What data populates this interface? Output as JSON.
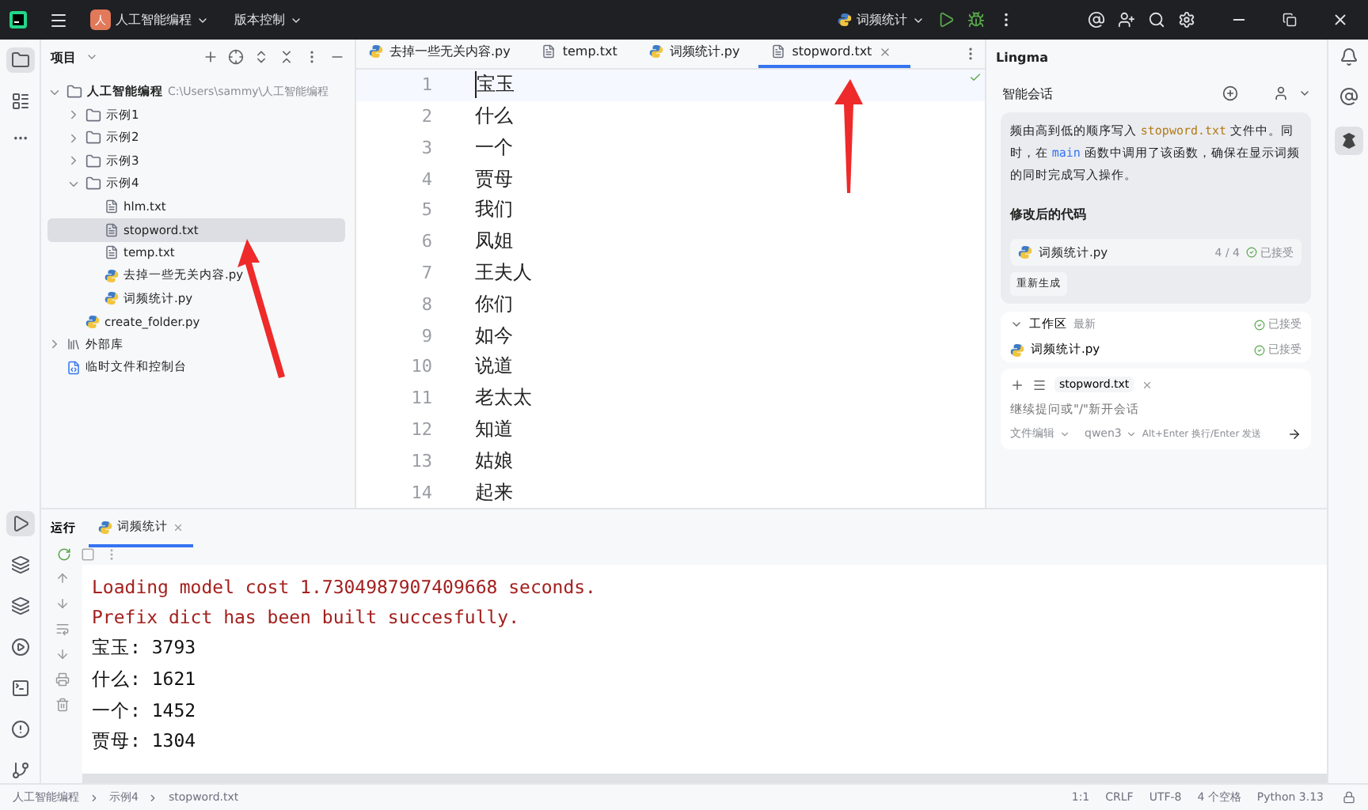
{
  "title_bar": {
    "project_badge": "人",
    "project": "人工智能编程",
    "vcs": "版本控制",
    "run_config": "词频统计"
  },
  "project_panel": {
    "title": "项目",
    "tree": [
      {
        "name": "人工智能编程",
        "path": "C:\\Users\\sammy\\人工智能编程",
        "kind": "folder",
        "expanded": true,
        "selected": false,
        "children": [
          {
            "name": "示例1",
            "kind": "folder",
            "expanded": false,
            "selected": false
          },
          {
            "name": "示例2",
            "kind": "folder",
            "expanded": false,
            "selected": false
          },
          {
            "name": "示例3",
            "kind": "folder",
            "expanded": false,
            "selected": false
          },
          {
            "name": "示例4",
            "kind": "folder",
            "expanded": true,
            "selected": false,
            "children": [
              {
                "name": "hlm.txt",
                "kind": "txt",
                "selected": false
              },
              {
                "name": "stopword.txt",
                "kind": "txt",
                "selected": true
              },
              {
                "name": "temp.txt",
                "kind": "txt",
                "selected": false
              },
              {
                "name": "去掉一些无关内容.py",
                "kind": "py",
                "selected": false
              },
              {
                "name": "词频统计.py",
                "kind": "py",
                "selected": false
              }
            ]
          },
          {
            "name": "create_folder.py",
            "kind": "py",
            "selected": false
          }
        ]
      },
      {
        "name": "外部库",
        "kind": "library",
        "expanded": false,
        "selected": false
      },
      {
        "name": "临时文件和控制台",
        "kind": "scratch",
        "selected": false
      }
    ]
  },
  "editor": {
    "tabs": [
      {
        "label": "去掉一些无关内容.py",
        "kind": "py",
        "selected": false
      },
      {
        "label": "temp.txt",
        "kind": "txt",
        "selected": false
      },
      {
        "label": "词频统计.py",
        "kind": "py",
        "selected": false
      },
      {
        "label": "stopword.txt",
        "kind": "txt",
        "selected": true
      }
    ],
    "lines": [
      {
        "number": "1",
        "text": "宝玉"
      },
      {
        "number": "2",
        "text": "什么"
      },
      {
        "number": "3",
        "text": "一个"
      },
      {
        "number": "4",
        "text": "贾母"
      },
      {
        "number": "5",
        "text": "我们"
      },
      {
        "number": "6",
        "text": "凤姐"
      },
      {
        "number": "7",
        "text": "王夫人"
      },
      {
        "number": "8",
        "text": "你们"
      },
      {
        "number": "9",
        "text": "如今"
      },
      {
        "number": "10",
        "text": "说道"
      },
      {
        "number": "11",
        "text": "老太太"
      },
      {
        "number": "12",
        "text": "知道"
      },
      {
        "number": "13",
        "text": "姑娘"
      },
      {
        "number": "14",
        "text": "起来"
      }
    ]
  },
  "lingma": {
    "title": "Lingma",
    "section": "智能会话",
    "message": [
      {
        "kind": "plain",
        "text": "频由高到低的顺序写入 "
      },
      {
        "kind": "code",
        "text": "stopword.txt"
      },
      {
        "kind": "plain",
        "text": " 文件中。同时，在 "
      },
      {
        "kind": "link",
        "text": "main"
      },
      {
        "kind": "plain",
        "text": " 函数中调用了该函数，确保在显示词频的同时完成写入操作。"
      }
    ],
    "heading": "修改后的代码",
    "file": {
      "name": "词频统计.py",
      "count": "4 / 4",
      "status": "已接受"
    },
    "regenerate": "重新生成",
    "workspace": {
      "label": "工作区",
      "filter": "最新",
      "status": "已接受",
      "files": [
        {
          "name": "词频统计.py",
          "status": "已接受"
        }
      ]
    },
    "input": {
      "chip": "stopword.txt",
      "placeholder": "继续提问或\"/\"新开会话",
      "mode": "文件编辑",
      "model": "qwen3",
      "hint": "Alt+Enter 换行/Enter 发送"
    }
  },
  "run_panel": {
    "title": "运行",
    "tab": "词频统计",
    "output": [
      {
        "kind": "stderr",
        "text": "Loading model cost 1.7304987907409668 seconds."
      },
      {
        "kind": "stderr",
        "text": "Prefix dict has been built succesfully."
      },
      {
        "kind": "stdout",
        "text": "宝玉: 3793"
      },
      {
        "kind": "stdout",
        "text": "什么: 1621"
      },
      {
        "kind": "stdout",
        "text": "一个: 1452"
      },
      {
        "kind": "stdout",
        "text": "贾母: 1304"
      }
    ]
  },
  "status_bar": {
    "breadcrumbs": [
      "人工智能编程",
      "示例4",
      "stopword.txt"
    ],
    "items": [
      "1:1",
      "CRLF",
      "UTF-8",
      "4 个空格",
      "Python 3.13"
    ]
  }
}
